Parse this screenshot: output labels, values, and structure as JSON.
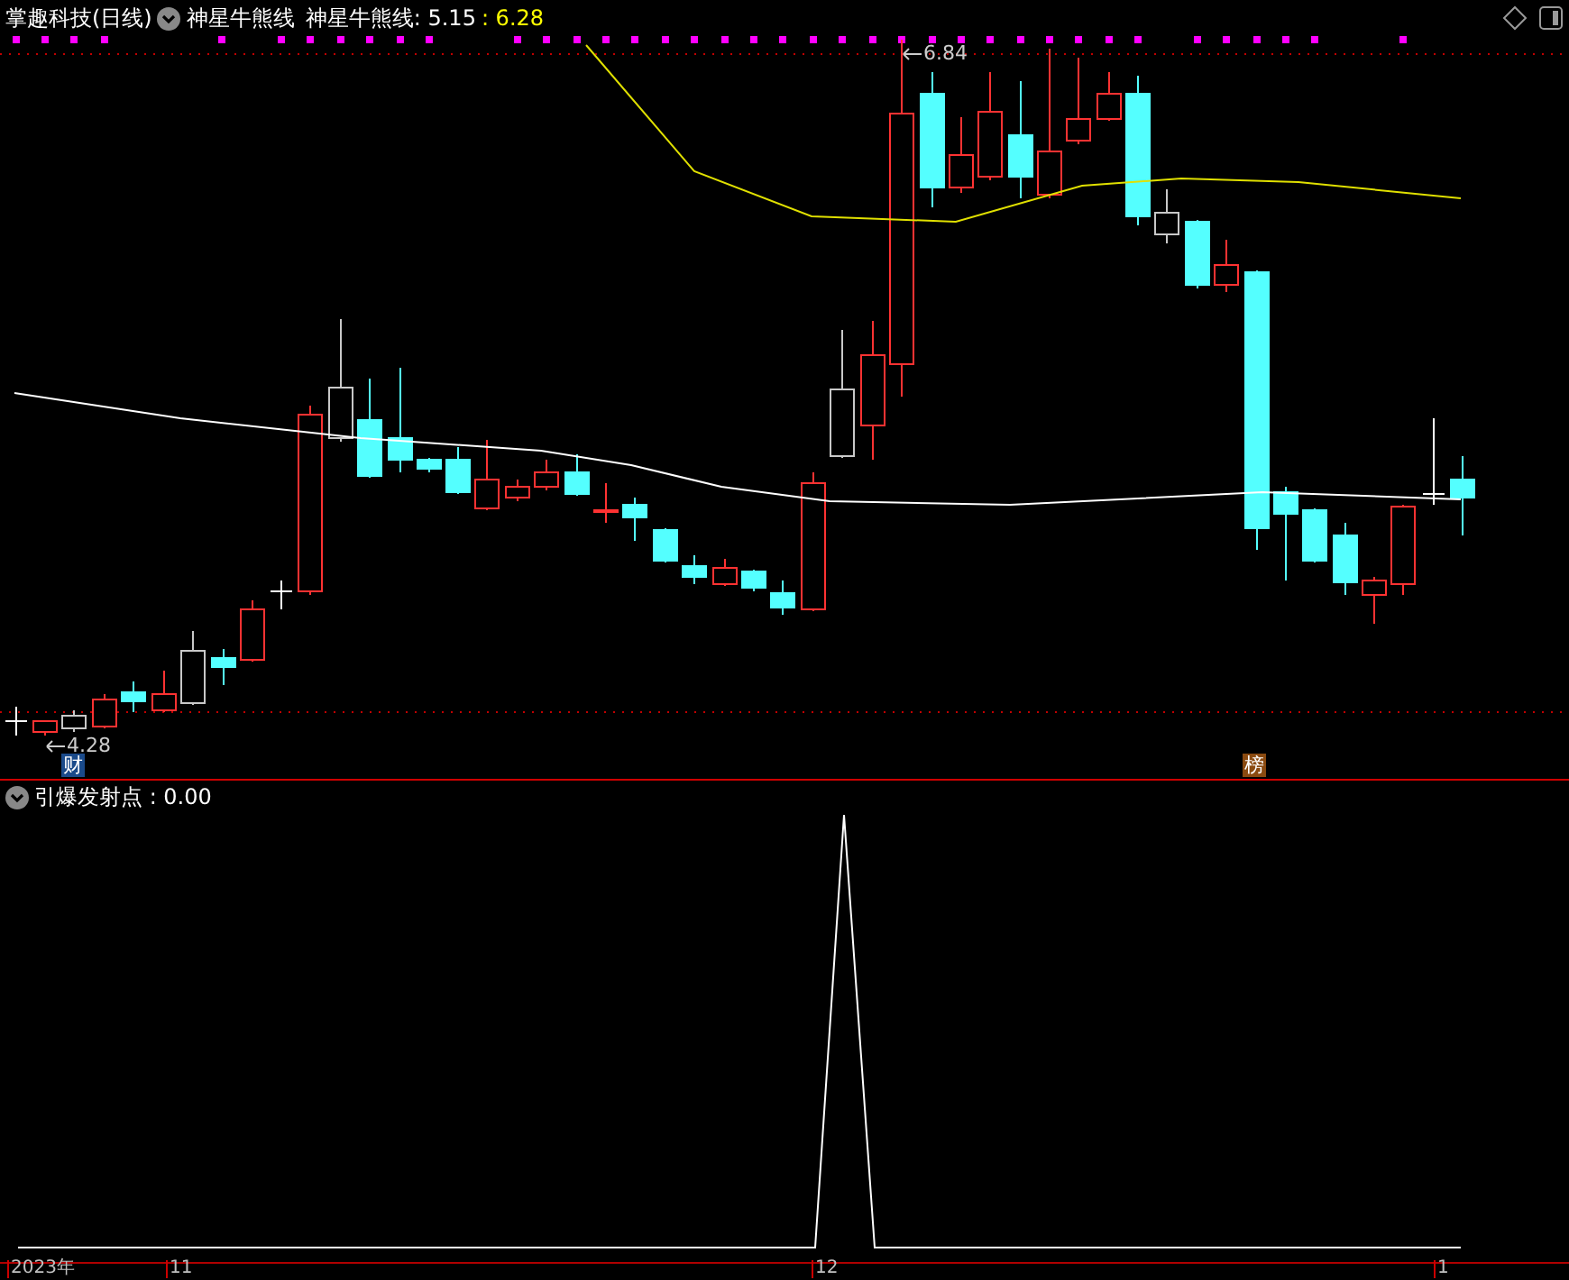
{
  "header": {
    "title": "掌趣科技(日线)",
    "indicator_menu": "神星牛熊线",
    "readings": [
      {
        "text": "神星牛熊线: 5.15",
        "color": "#ffffff"
      },
      {
        "text": ": 6.28",
        "color": "#ffff00"
      }
    ]
  },
  "main_chart": {
    "high_label": "6.84",
    "low_label": "4.28",
    "tags": [
      {
        "text": "财",
        "kind": "finance"
      },
      {
        "text": "榜",
        "kind": "ranking"
      }
    ]
  },
  "sub_chart": {
    "reading": "引爆发射点 : 0.00"
  },
  "x_axis": {
    "labels": [
      "2023年",
      "11",
      "12",
      "1"
    ]
  }
}
